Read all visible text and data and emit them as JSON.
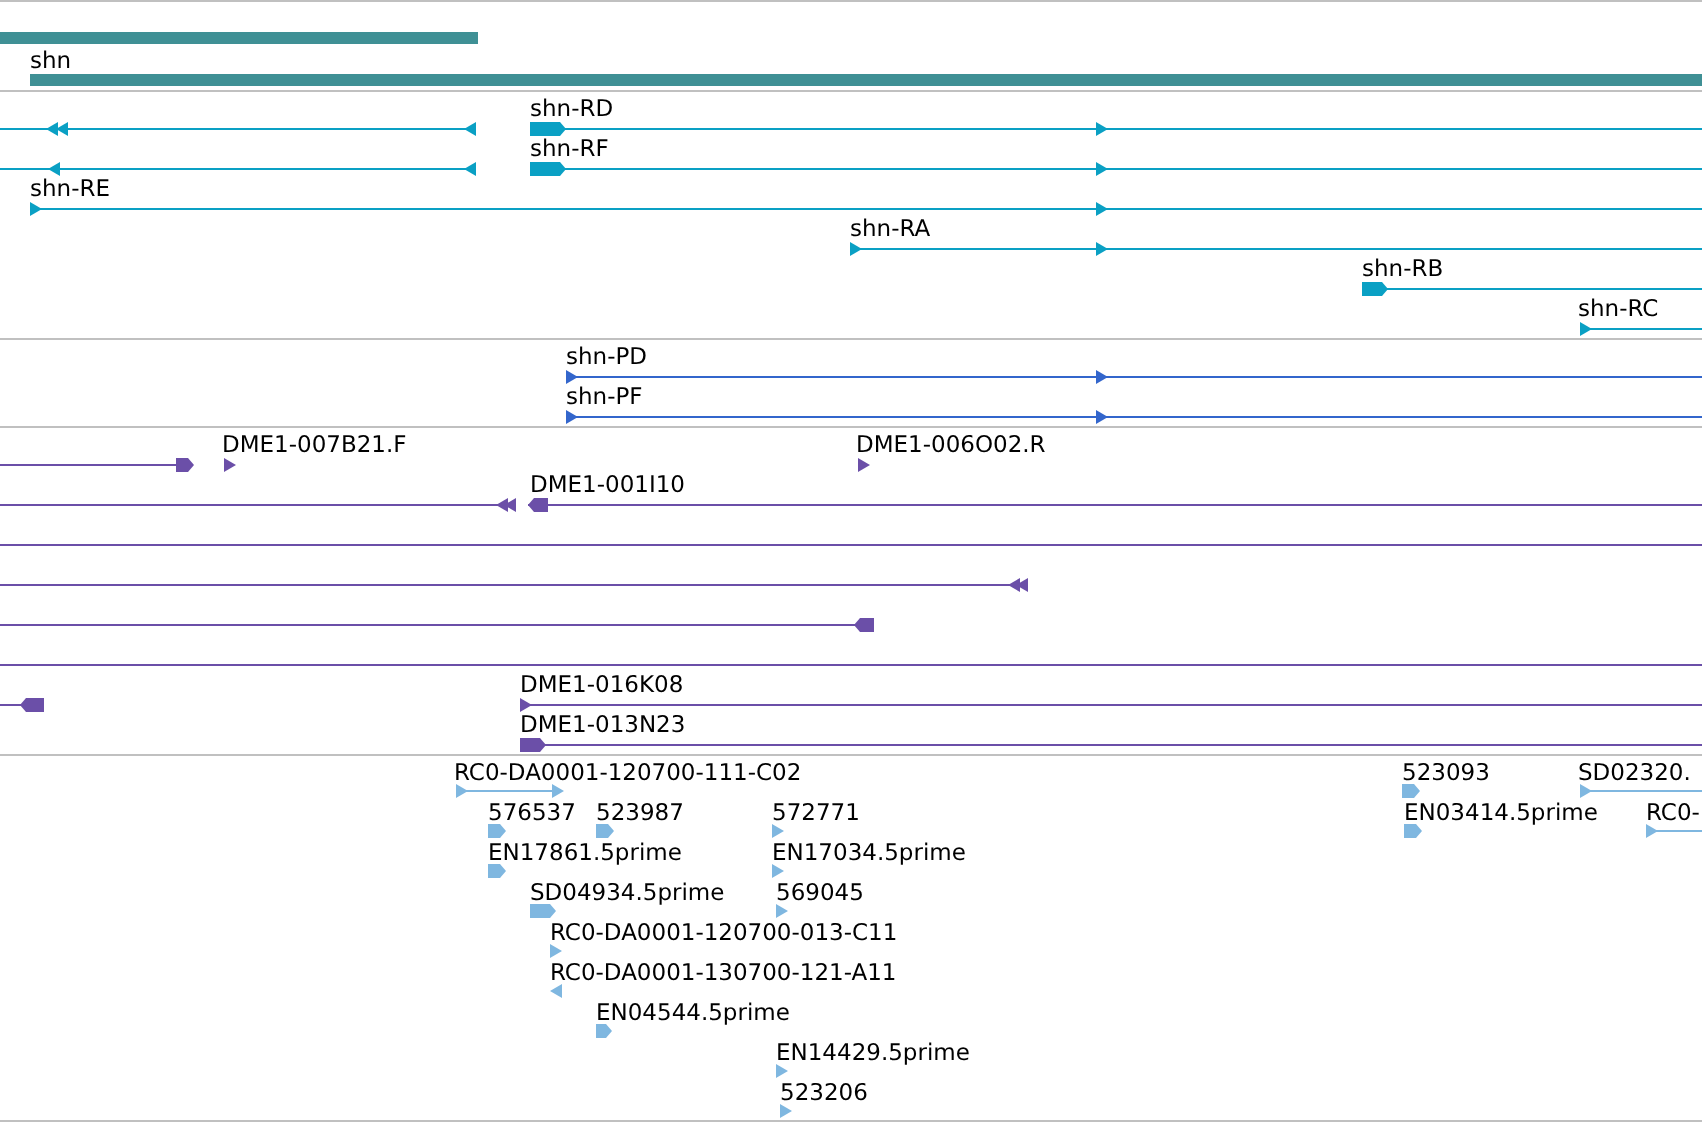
{
  "tracks": [
    {
      "kind": "gene",
      "labels": [
        "shn"
      ]
    },
    {
      "kind": "transcript",
      "labels": [
        "shn-RD",
        "shn-RF",
        "shn-RE",
        "shn-RA",
        "shn-RB",
        "shn-RC"
      ]
    },
    {
      "kind": "protein",
      "labels": [
        "shn-PD",
        "shn-PF"
      ]
    },
    {
      "kind": "clone",
      "labels": [
        "DME1-007B21.F",
        "DME1-006O02.R",
        "DME1-001I10",
        "DME1-016K08",
        "DME1-013N23"
      ]
    },
    {
      "kind": "est",
      "labels": [
        "RC0-DA0001-120700-111-C02",
        "576537",
        "523987",
        "572771",
        "EN17861.5prime",
        "EN17034.5prime",
        "SD04934.5prime",
        "569045",
        "RC0-DA0001-120700-013-C11",
        "RC0-DA0001-130700-121-A11",
        "EN04544.5prime",
        "EN14429.5prime",
        "523206",
        "523093",
        "SD02320.",
        "EN03414.5prime",
        "RC0-"
      ]
    }
  ]
}
